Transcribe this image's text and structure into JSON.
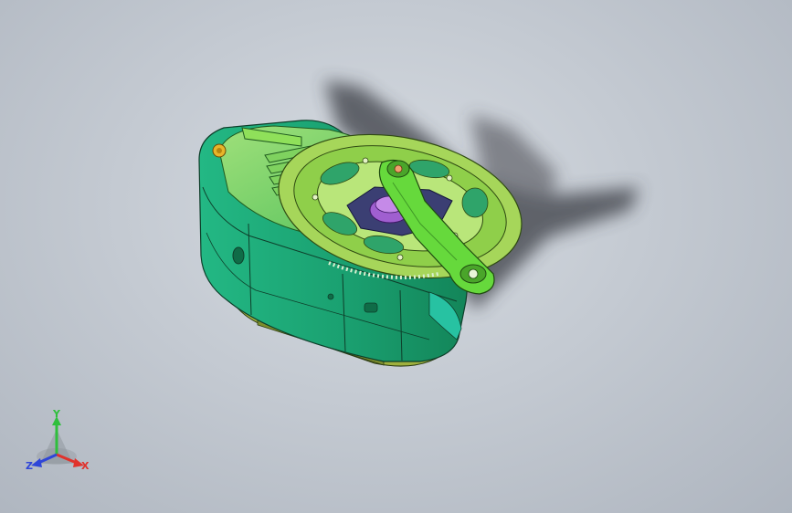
{
  "viewport": {
    "background_top": "#d6dbe1",
    "background_bottom": "#aeb5bf"
  },
  "model": {
    "housing_color": "#1fae7a",
    "housing_dark_color": "#158a5e",
    "chainring_color": "#8fcf4a",
    "crank_arm_color": "#66d93c",
    "hub_color": "#a05fd0",
    "spider_color": "#3b3f73",
    "base_color": "#9fb03d",
    "bolt_color": "#e7b52a",
    "shadow_color": "#3a3d44",
    "icon": "motor-housing-icon"
  },
  "triad": {
    "x_label": "X",
    "y_label": "Y",
    "z_label": "Z",
    "x_color": "#e0322c",
    "y_color": "#2fbf3c",
    "z_color": "#2f46d8"
  }
}
